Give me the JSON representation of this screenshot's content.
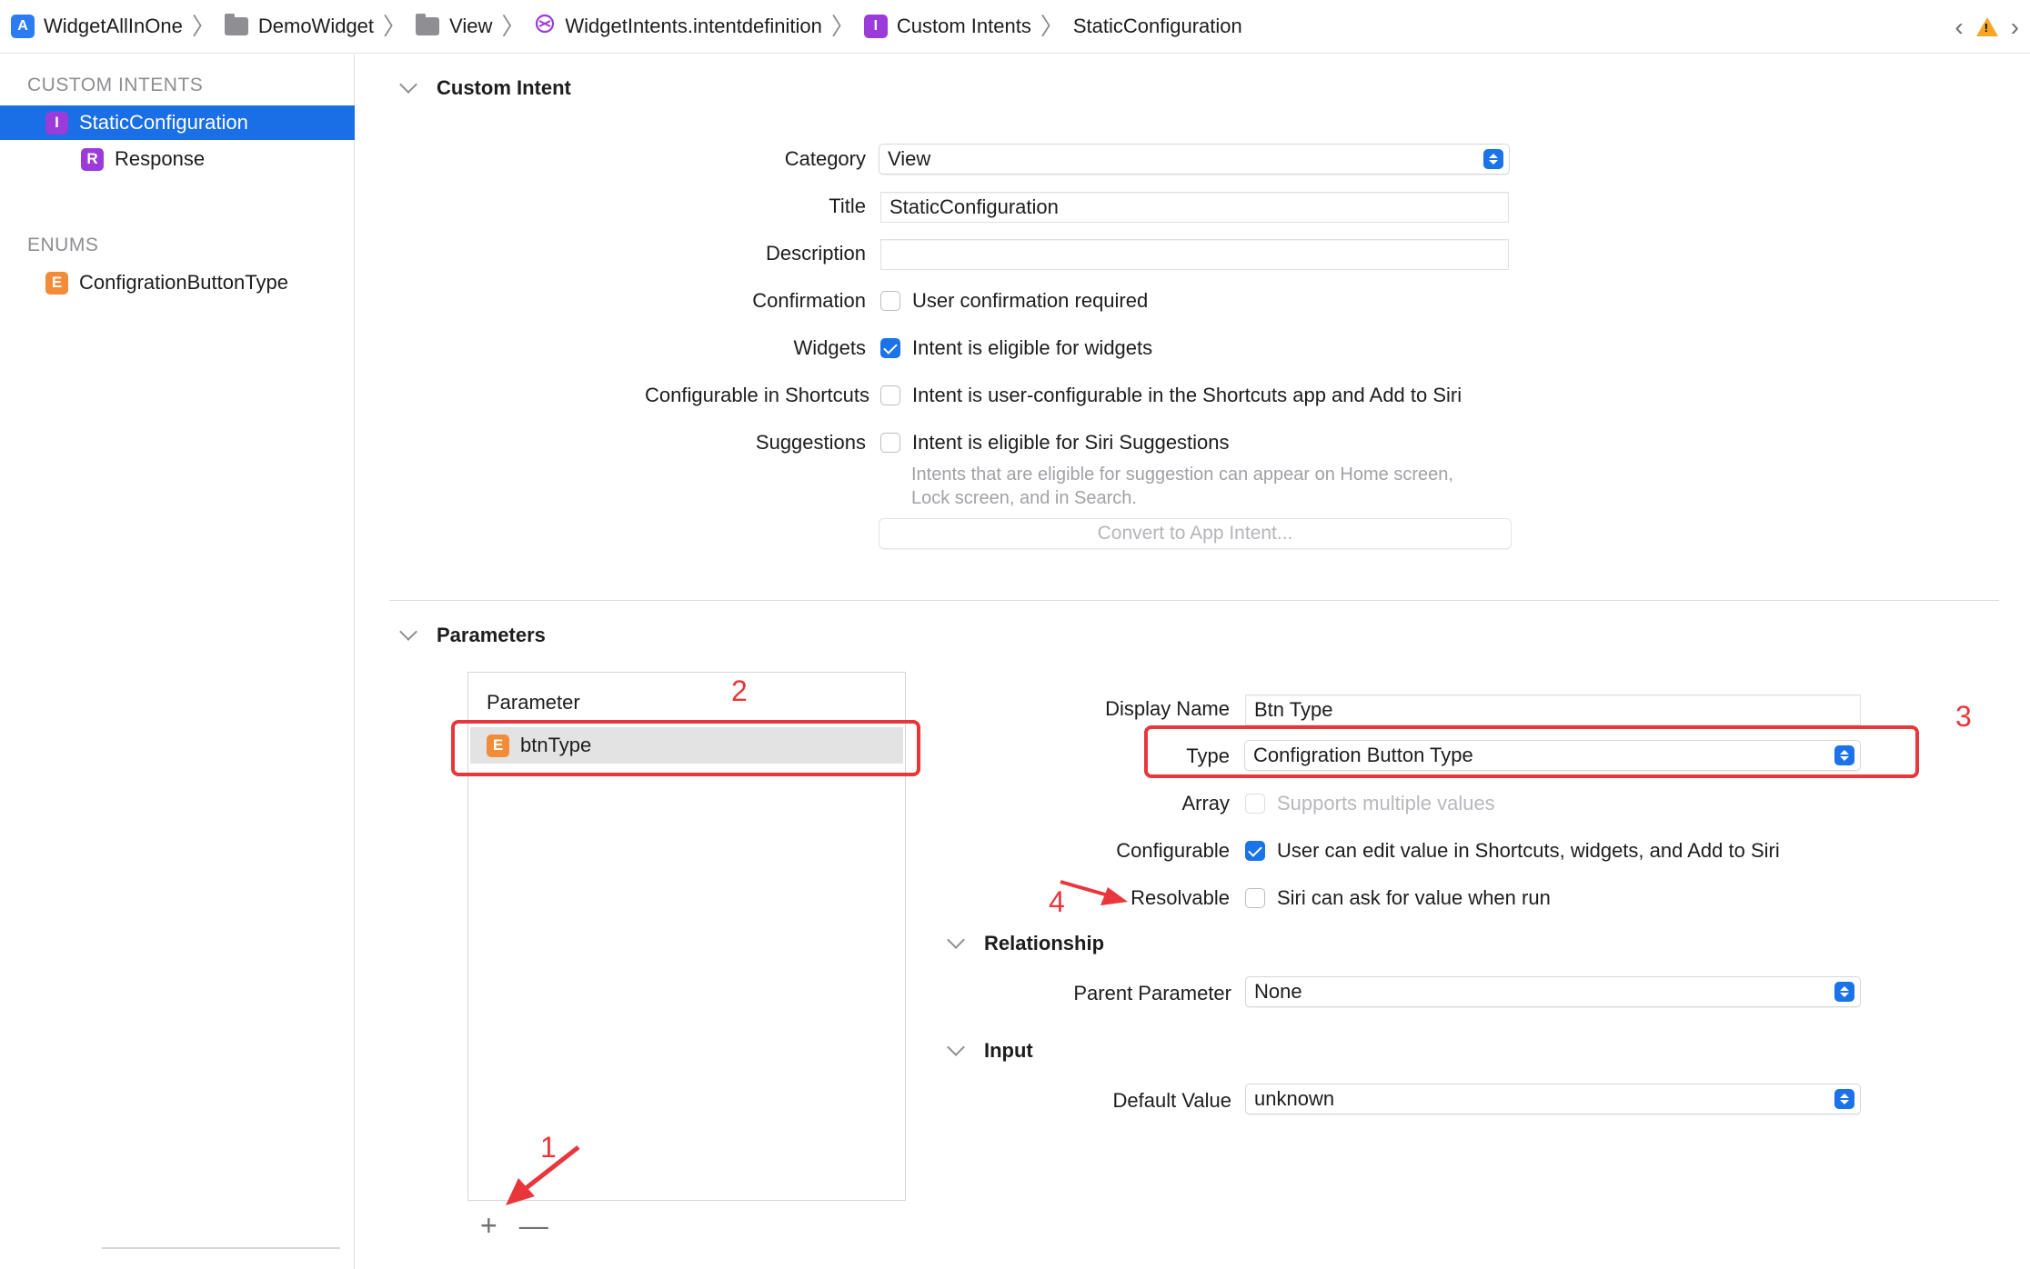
{
  "breadcrumb": {
    "project": "WidgetAllInOne",
    "folder1": "DemoWidget",
    "folder2": "View",
    "file": "WidgetIntents.intentdefinition",
    "group": "Custom Intents",
    "item": "StaticConfiguration"
  },
  "sidebar": {
    "custom_intents_header": "CUSTOM INTENTS",
    "items": [
      {
        "badge": "I",
        "label": "StaticConfiguration",
        "selected": true
      },
      {
        "badge": "R",
        "label": "Response",
        "selected": false
      }
    ],
    "enums_header": "ENUMS",
    "enums": [
      {
        "badge": "E",
        "label": "ConfigrationButtonType"
      }
    ]
  },
  "custom_intent": {
    "section_title": "Custom Intent",
    "category_label": "Category",
    "category_value": "View",
    "title_label": "Title",
    "title_value": "StaticConfiguration",
    "description_label": "Description",
    "description_value": "",
    "confirmation_label": "Confirmation",
    "confirmation_text": "User confirmation required",
    "confirmation_checked": false,
    "widgets_label": "Widgets",
    "widgets_text": "Intent is eligible for widgets",
    "widgets_checked": true,
    "configurable_label": "Configurable in Shortcuts",
    "configurable_text": "Intent is user-configurable in the Shortcuts app and Add to Siri",
    "configurable_checked": false,
    "suggestions_label": "Suggestions",
    "suggestions_text": "Intent is eligible for Siri Suggestions",
    "suggestions_checked": false,
    "suggestions_hint_line1": "Intents that are eligible for suggestion can appear on Home screen,",
    "suggestions_hint_line2": "Lock screen, and in Search.",
    "convert_button": "Convert to App Intent..."
  },
  "parameters": {
    "section_title": "Parameters",
    "list_header": "Parameter",
    "rows": [
      {
        "badge": "E",
        "name": "btnType"
      }
    ],
    "add_label": "+",
    "remove_label": "—",
    "display_name_label": "Display Name",
    "display_name_value": "Btn Type",
    "type_label": "Type",
    "type_value": "Configration Button Type",
    "array_label": "Array",
    "array_text": "Supports multiple values",
    "configurable_label": "Configurable",
    "configurable_text": "User can edit value in Shortcuts, widgets, and Add to Siri",
    "configurable_checked": true,
    "resolvable_label": "Resolvable",
    "resolvable_text": "Siri can ask for value when run",
    "resolvable_checked": false,
    "relationship_title": "Relationship",
    "parent_label": "Parent Parameter",
    "parent_value": "None",
    "input_title": "Input",
    "default_label": "Default Value",
    "default_value": "unknown"
  },
  "annotations": {
    "n1": "1",
    "n2": "2",
    "n3": "3",
    "n4": "4",
    "color": "#e8363b"
  },
  "colors": {
    "accent": "#1a73e8",
    "selection": "#1a6ee6",
    "intent_badge": "#9b3bd9",
    "enum_badge": "#f28c38",
    "warning": "#f5a623"
  }
}
